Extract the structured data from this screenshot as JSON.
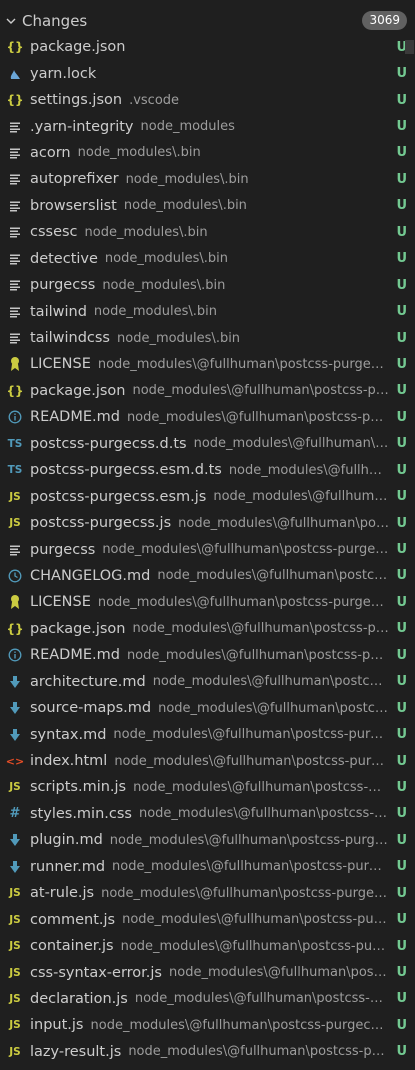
{
  "header": {
    "title": "Changes",
    "count": "3069"
  },
  "status_color": "#73c991",
  "colors": {
    "json": "#cbcb41",
    "yarn": "#6aa6d8",
    "lines": "#c5c5c5",
    "license": "#cbcb41",
    "info": "#519aba",
    "ts": "#519aba",
    "js": "#cbcb41",
    "clock": "#519aba",
    "md": "#519aba",
    "html": "#e44d26",
    "css": "#519aba"
  },
  "files": [
    {
      "name": "package.json",
      "dir": "",
      "icon": "json",
      "status": "U"
    },
    {
      "name": "yarn.lock",
      "dir": "",
      "icon": "yarn",
      "status": "U"
    },
    {
      "name": "settings.json",
      "dir": ".vscode",
      "icon": "json",
      "status": "U"
    },
    {
      "name": ".yarn-integrity",
      "dir": "node_modules",
      "icon": "lines",
      "status": "U"
    },
    {
      "name": "acorn",
      "dir": "node_modules\\.bin",
      "icon": "lines",
      "status": "U"
    },
    {
      "name": "autoprefixer",
      "dir": "node_modules\\.bin",
      "icon": "lines",
      "status": "U"
    },
    {
      "name": "browserslist",
      "dir": "node_modules\\.bin",
      "icon": "lines",
      "status": "U"
    },
    {
      "name": "cssesc",
      "dir": "node_modules\\.bin",
      "icon": "lines",
      "status": "U"
    },
    {
      "name": "detective",
      "dir": "node_modules\\.bin",
      "icon": "lines",
      "status": "U"
    },
    {
      "name": "purgecss",
      "dir": "node_modules\\.bin",
      "icon": "lines",
      "status": "U"
    },
    {
      "name": "tailwind",
      "dir": "node_modules\\.bin",
      "icon": "lines",
      "status": "U"
    },
    {
      "name": "tailwindcss",
      "dir": "node_modules\\.bin",
      "icon": "lines",
      "status": "U"
    },
    {
      "name": "LICENSE",
      "dir": "node_modules\\@fullhuman\\postcss-purgecss",
      "icon": "license",
      "status": "U"
    },
    {
      "name": "package.json",
      "dir": "node_modules\\@fullhuman\\postcss-pur...",
      "icon": "json",
      "status": "U"
    },
    {
      "name": "README.md",
      "dir": "node_modules\\@fullhuman\\postcss-purg...",
      "icon": "info",
      "status": "U"
    },
    {
      "name": "postcss-purgecss.d.ts",
      "dir": "node_modules\\@fullhuman\\po...",
      "icon": "ts",
      "status": "U"
    },
    {
      "name": "postcss-purgecss.esm.d.ts",
      "dir": "node_modules\\@fullhuma...",
      "icon": "ts",
      "status": "U"
    },
    {
      "name": "postcss-purgecss.esm.js",
      "dir": "node_modules\\@fullhuman\\...",
      "icon": "js",
      "status": "U"
    },
    {
      "name": "postcss-purgecss.js",
      "dir": "node_modules\\@fullhuman\\postc...",
      "icon": "js",
      "status": "U"
    },
    {
      "name": "purgecss",
      "dir": "node_modules\\@fullhuman\\postcss-purgecss...",
      "icon": "lines",
      "status": "U"
    },
    {
      "name": "CHANGELOG.md",
      "dir": "node_modules\\@fullhuman\\postcss-...",
      "icon": "clock",
      "status": "U"
    },
    {
      "name": "LICENSE",
      "dir": "node_modules\\@fullhuman\\postcss-purgecss\\...",
      "icon": "license",
      "status": "U"
    },
    {
      "name": "package.json",
      "dir": "node_modules\\@fullhuman\\postcss-pur...",
      "icon": "json",
      "status": "U"
    },
    {
      "name": "README.md",
      "dir": "node_modules\\@fullhuman\\postcss-purg...",
      "icon": "info",
      "status": "U"
    },
    {
      "name": "architecture.md",
      "dir": "node_modules\\@fullhuman\\postcss-p...",
      "icon": "md",
      "status": "U"
    },
    {
      "name": "source-maps.md",
      "dir": "node_modules\\@fullhuman\\postcss-...",
      "icon": "md",
      "status": "U"
    },
    {
      "name": "syntax.md",
      "dir": "node_modules\\@fullhuman\\postcss-purgec...",
      "icon": "md",
      "status": "U"
    },
    {
      "name": "index.html",
      "dir": "node_modules\\@fullhuman\\postcss-purgec...",
      "icon": "html",
      "status": "U"
    },
    {
      "name": "scripts.min.js",
      "dir": "node_modules\\@fullhuman\\postcss-pur...",
      "icon": "js",
      "status": "U"
    },
    {
      "name": "styles.min.css",
      "dir": "node_modules\\@fullhuman\\postcss-pur...",
      "icon": "css",
      "status": "U"
    },
    {
      "name": "plugin.md",
      "dir": "node_modules\\@fullhuman\\postcss-purgec...",
      "icon": "md",
      "status": "U"
    },
    {
      "name": "runner.md",
      "dir": "node_modules\\@fullhuman\\postcss-purgec...",
      "icon": "md",
      "status": "U"
    },
    {
      "name": "at-rule.js",
      "dir": "node_modules\\@fullhuman\\postcss-purgecss...",
      "icon": "js",
      "status": "U"
    },
    {
      "name": "comment.js",
      "dir": "node_modules\\@fullhuman\\postcss-purge...",
      "icon": "js",
      "status": "U"
    },
    {
      "name": "container.js",
      "dir": "node_modules\\@fullhuman\\postcss-purge...",
      "icon": "js",
      "status": "U"
    },
    {
      "name": "css-syntax-error.js",
      "dir": "node_modules\\@fullhuman\\postcs...",
      "icon": "js",
      "status": "U"
    },
    {
      "name": "declaration.js",
      "dir": "node_modules\\@fullhuman\\postcss-pur...",
      "icon": "js",
      "status": "U"
    },
    {
      "name": "input.js",
      "dir": "node_modules\\@fullhuman\\postcss-purgecss\\...",
      "icon": "js",
      "status": "U"
    },
    {
      "name": "lazy-result.js",
      "dir": "node_modules\\@fullhuman\\postcss-purg...",
      "icon": "js",
      "status": "U"
    }
  ]
}
